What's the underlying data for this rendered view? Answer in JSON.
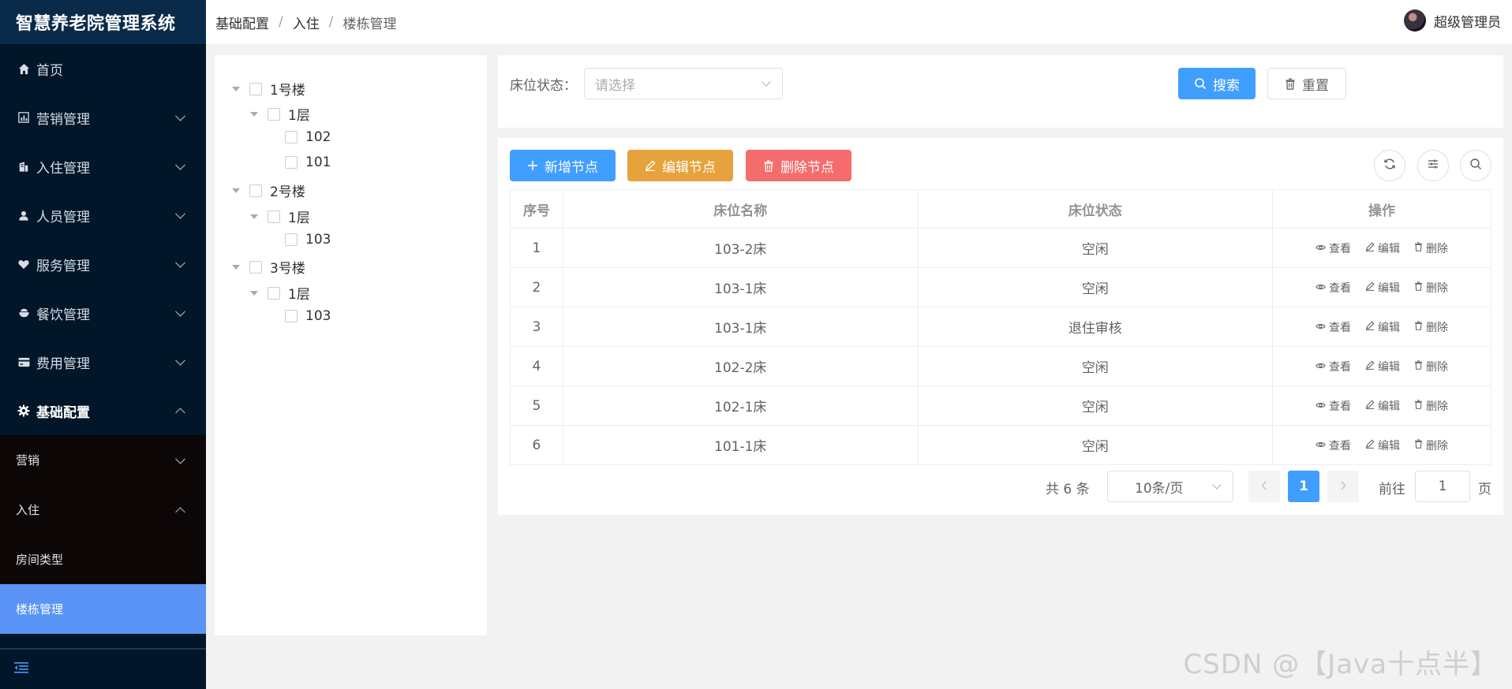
{
  "app": {
    "title": "智慧养老院管理系统"
  },
  "sidebar": {
    "items": [
      {
        "label": "首页",
        "icon": "home-icon"
      },
      {
        "label": "营销管理",
        "icon": "chart-icon"
      },
      {
        "label": "入住管理",
        "icon": "building-icon"
      },
      {
        "label": "人员管理",
        "icon": "user-icon"
      },
      {
        "label": "服务管理",
        "icon": "service-icon"
      },
      {
        "label": "餐饮管理",
        "icon": "bowl-icon"
      },
      {
        "label": "费用管理",
        "icon": "card-icon"
      },
      {
        "label": "基础配置",
        "icon": "gear-icon"
      }
    ],
    "sub_items": [
      {
        "label": "营销"
      },
      {
        "label": "入住"
      },
      {
        "label": "房间类型"
      },
      {
        "label": "楼栋管理"
      }
    ]
  },
  "header": {
    "breadcrumb": [
      "基础配置",
      "入住",
      "楼栋管理"
    ],
    "separator": "/",
    "user_name": "超级管理员"
  },
  "tree": {
    "nodes": [
      {
        "label": "1号楼"
      },
      {
        "label": "1层"
      },
      {
        "label": "102"
      },
      {
        "label": "101"
      },
      {
        "label": "2号楼"
      },
      {
        "label": "1层"
      },
      {
        "label": "103"
      },
      {
        "label": "3号楼"
      },
      {
        "label": "1层"
      },
      {
        "label": "103"
      }
    ]
  },
  "search": {
    "label": "床位状态：",
    "placeholder": "请选择",
    "search_button": "搜索",
    "reset_button": "重置"
  },
  "toolbar": {
    "add_node": "新增节点",
    "edit_node": "编辑节点",
    "delete_node": "删除节点"
  },
  "table": {
    "columns": [
      "序号",
      "床位名称",
      "床位状态",
      "操作"
    ],
    "rows": [
      {
        "index": "1",
        "name": "103-2床",
        "status": "空闲"
      },
      {
        "index": "2",
        "name": "103-1床",
        "status": "空闲"
      },
      {
        "index": "3",
        "name": "103-1床",
        "status": "退住审核"
      },
      {
        "index": "4",
        "name": "102-2床",
        "status": "空闲"
      },
      {
        "index": "5",
        "name": "102-1床",
        "status": "空闲"
      },
      {
        "index": "6",
        "name": "101-1床",
        "status": "空闲"
      }
    ],
    "actions": {
      "view": "查看",
      "edit": "编辑",
      "delete": "删除"
    }
  },
  "pagination": {
    "total_text": "共 6 条",
    "page_size": "10条/页",
    "current_page": "1",
    "goto_label": "前往",
    "goto_value": "1",
    "page_unit": "页"
  },
  "watermark": "CSDN @【Java十点半】",
  "colors": {
    "sidebar_bg": "#011628",
    "selected_item": "#5b94f7",
    "primary": "#409eff",
    "warning": "#e6a23c",
    "danger": "#f56c6c"
  }
}
